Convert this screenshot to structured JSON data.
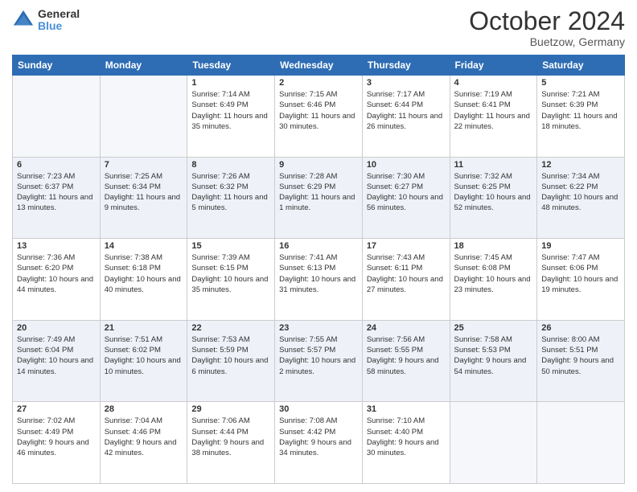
{
  "header": {
    "logo_line1": "General",
    "logo_line2": "Blue",
    "month": "October 2024",
    "location": "Buetzow, Germany"
  },
  "weekdays": [
    "Sunday",
    "Monday",
    "Tuesday",
    "Wednesday",
    "Thursday",
    "Friday",
    "Saturday"
  ],
  "weeks": [
    [
      {
        "day": "",
        "sunrise": "",
        "sunset": "",
        "daylight": ""
      },
      {
        "day": "",
        "sunrise": "",
        "sunset": "",
        "daylight": ""
      },
      {
        "day": "1",
        "sunrise": "Sunrise: 7:14 AM",
        "sunset": "Sunset: 6:49 PM",
        "daylight": "Daylight: 11 hours and 35 minutes."
      },
      {
        "day": "2",
        "sunrise": "Sunrise: 7:15 AM",
        "sunset": "Sunset: 6:46 PM",
        "daylight": "Daylight: 11 hours and 30 minutes."
      },
      {
        "day": "3",
        "sunrise": "Sunrise: 7:17 AM",
        "sunset": "Sunset: 6:44 PM",
        "daylight": "Daylight: 11 hours and 26 minutes."
      },
      {
        "day": "4",
        "sunrise": "Sunrise: 7:19 AM",
        "sunset": "Sunset: 6:41 PM",
        "daylight": "Daylight: 11 hours and 22 minutes."
      },
      {
        "day": "5",
        "sunrise": "Sunrise: 7:21 AM",
        "sunset": "Sunset: 6:39 PM",
        "daylight": "Daylight: 11 hours and 18 minutes."
      }
    ],
    [
      {
        "day": "6",
        "sunrise": "Sunrise: 7:23 AM",
        "sunset": "Sunset: 6:37 PM",
        "daylight": "Daylight: 11 hours and 13 minutes."
      },
      {
        "day": "7",
        "sunrise": "Sunrise: 7:25 AM",
        "sunset": "Sunset: 6:34 PM",
        "daylight": "Daylight: 11 hours and 9 minutes."
      },
      {
        "day": "8",
        "sunrise": "Sunrise: 7:26 AM",
        "sunset": "Sunset: 6:32 PM",
        "daylight": "Daylight: 11 hours and 5 minutes."
      },
      {
        "day": "9",
        "sunrise": "Sunrise: 7:28 AM",
        "sunset": "Sunset: 6:29 PM",
        "daylight": "Daylight: 11 hours and 1 minute."
      },
      {
        "day": "10",
        "sunrise": "Sunrise: 7:30 AM",
        "sunset": "Sunset: 6:27 PM",
        "daylight": "Daylight: 10 hours and 56 minutes."
      },
      {
        "day": "11",
        "sunrise": "Sunrise: 7:32 AM",
        "sunset": "Sunset: 6:25 PM",
        "daylight": "Daylight: 10 hours and 52 minutes."
      },
      {
        "day": "12",
        "sunrise": "Sunrise: 7:34 AM",
        "sunset": "Sunset: 6:22 PM",
        "daylight": "Daylight: 10 hours and 48 minutes."
      }
    ],
    [
      {
        "day": "13",
        "sunrise": "Sunrise: 7:36 AM",
        "sunset": "Sunset: 6:20 PM",
        "daylight": "Daylight: 10 hours and 44 minutes."
      },
      {
        "day": "14",
        "sunrise": "Sunrise: 7:38 AM",
        "sunset": "Sunset: 6:18 PM",
        "daylight": "Daylight: 10 hours and 40 minutes."
      },
      {
        "day": "15",
        "sunrise": "Sunrise: 7:39 AM",
        "sunset": "Sunset: 6:15 PM",
        "daylight": "Daylight: 10 hours and 35 minutes."
      },
      {
        "day": "16",
        "sunrise": "Sunrise: 7:41 AM",
        "sunset": "Sunset: 6:13 PM",
        "daylight": "Daylight: 10 hours and 31 minutes."
      },
      {
        "day": "17",
        "sunrise": "Sunrise: 7:43 AM",
        "sunset": "Sunset: 6:11 PM",
        "daylight": "Daylight: 10 hours and 27 minutes."
      },
      {
        "day": "18",
        "sunrise": "Sunrise: 7:45 AM",
        "sunset": "Sunset: 6:08 PM",
        "daylight": "Daylight: 10 hours and 23 minutes."
      },
      {
        "day": "19",
        "sunrise": "Sunrise: 7:47 AM",
        "sunset": "Sunset: 6:06 PM",
        "daylight": "Daylight: 10 hours and 19 minutes."
      }
    ],
    [
      {
        "day": "20",
        "sunrise": "Sunrise: 7:49 AM",
        "sunset": "Sunset: 6:04 PM",
        "daylight": "Daylight: 10 hours and 14 minutes."
      },
      {
        "day": "21",
        "sunrise": "Sunrise: 7:51 AM",
        "sunset": "Sunset: 6:02 PM",
        "daylight": "Daylight: 10 hours and 10 minutes."
      },
      {
        "day": "22",
        "sunrise": "Sunrise: 7:53 AM",
        "sunset": "Sunset: 5:59 PM",
        "daylight": "Daylight: 10 hours and 6 minutes."
      },
      {
        "day": "23",
        "sunrise": "Sunrise: 7:55 AM",
        "sunset": "Sunset: 5:57 PM",
        "daylight": "Daylight: 10 hours and 2 minutes."
      },
      {
        "day": "24",
        "sunrise": "Sunrise: 7:56 AM",
        "sunset": "Sunset: 5:55 PM",
        "daylight": "Daylight: 9 hours and 58 minutes."
      },
      {
        "day": "25",
        "sunrise": "Sunrise: 7:58 AM",
        "sunset": "Sunset: 5:53 PM",
        "daylight": "Daylight: 9 hours and 54 minutes."
      },
      {
        "day": "26",
        "sunrise": "Sunrise: 8:00 AM",
        "sunset": "Sunset: 5:51 PM",
        "daylight": "Daylight: 9 hours and 50 minutes."
      }
    ],
    [
      {
        "day": "27",
        "sunrise": "Sunrise: 7:02 AM",
        "sunset": "Sunset: 4:49 PM",
        "daylight": "Daylight: 9 hours and 46 minutes."
      },
      {
        "day": "28",
        "sunrise": "Sunrise: 7:04 AM",
        "sunset": "Sunset: 4:46 PM",
        "daylight": "Daylight: 9 hours and 42 minutes."
      },
      {
        "day": "29",
        "sunrise": "Sunrise: 7:06 AM",
        "sunset": "Sunset: 4:44 PM",
        "daylight": "Daylight: 9 hours and 38 minutes."
      },
      {
        "day": "30",
        "sunrise": "Sunrise: 7:08 AM",
        "sunset": "Sunset: 4:42 PM",
        "daylight": "Daylight: 9 hours and 34 minutes."
      },
      {
        "day": "31",
        "sunrise": "Sunrise: 7:10 AM",
        "sunset": "Sunset: 4:40 PM",
        "daylight": "Daylight: 9 hours and 30 minutes."
      },
      {
        "day": "",
        "sunrise": "",
        "sunset": "",
        "daylight": ""
      },
      {
        "day": "",
        "sunrise": "",
        "sunset": "",
        "daylight": ""
      }
    ]
  ]
}
